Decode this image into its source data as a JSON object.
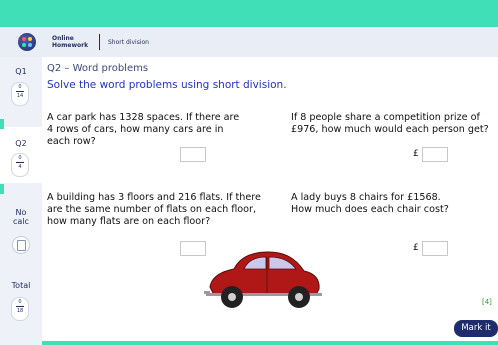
{
  "header": {
    "brand_line1": "Online",
    "brand_line2": "Homework",
    "breadcrumb": "Short division"
  },
  "sidebar": {
    "items": [
      {
        "label": "Q1",
        "score": "0",
        "total": "14"
      },
      {
        "label": "Q2",
        "score": "0",
        "total": "4"
      },
      {
        "label_line1": "No",
        "label_line2": "calc"
      },
      {
        "label": "Total",
        "score": "0",
        "total": "18"
      }
    ]
  },
  "main": {
    "subtitle": "Q2 – Word problems",
    "title": "Solve the word problems using short division.",
    "questions": [
      {
        "lines": [
          "A car park has 1328 spaces. If there are",
          "4 rows of cars, how many cars are in",
          "each row?"
        ],
        "prefix": ""
      },
      {
        "lines": [
          "If 8 people share a competition prize of",
          "£976, how much would each person get?"
        ],
        "prefix": "£"
      },
      {
        "lines": [
          "A building has 3 floors and 216 flats. If there",
          "are the same number of flats on each floor,",
          "how many flats are on each floor?"
        ],
        "prefix": ""
      },
      {
        "lines": [
          "A lady buys 8 chairs for £1568.",
          "How much does each chair cost?"
        ],
        "prefix": "£"
      }
    ],
    "marks": "[4]",
    "mark_button": "Mark it"
  },
  "colors": {
    "accent": "#40dfb8",
    "navy": "#1f2d6e",
    "title_blue": "#2233bb",
    "car_red": "#b01818"
  }
}
